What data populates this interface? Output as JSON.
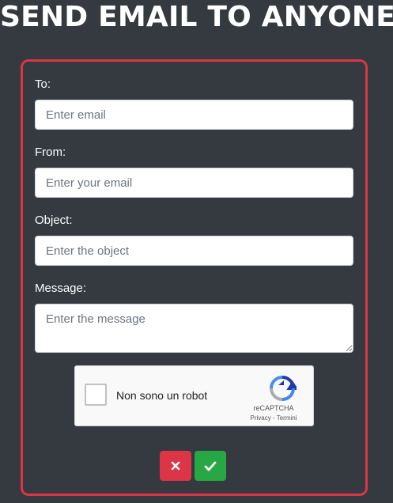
{
  "page": {
    "title": "SEND EMAIL TO ANYONE"
  },
  "form": {
    "to": {
      "label": "To:",
      "placeholder": "Enter email",
      "value": ""
    },
    "from": {
      "label": "From:",
      "placeholder": "Enter your email",
      "value": ""
    },
    "object": {
      "label": "Object:",
      "placeholder": "Enter the object",
      "value": ""
    },
    "message": {
      "label": "Message:",
      "placeholder": "Enter the message",
      "value": ""
    }
  },
  "recaptcha": {
    "label": "Non sono un robot",
    "brand": "reCAPTCHA",
    "privacy": "Privacy",
    "separator": " - ",
    "terms": "Termini",
    "checked": false
  },
  "buttons": {
    "cancel": {
      "icon": "x-icon",
      "color": "#dc3545"
    },
    "send": {
      "icon": "check-icon",
      "color": "#28a745"
    }
  },
  "colors": {
    "background": "#343a40",
    "card_border": "#dc3545"
  }
}
